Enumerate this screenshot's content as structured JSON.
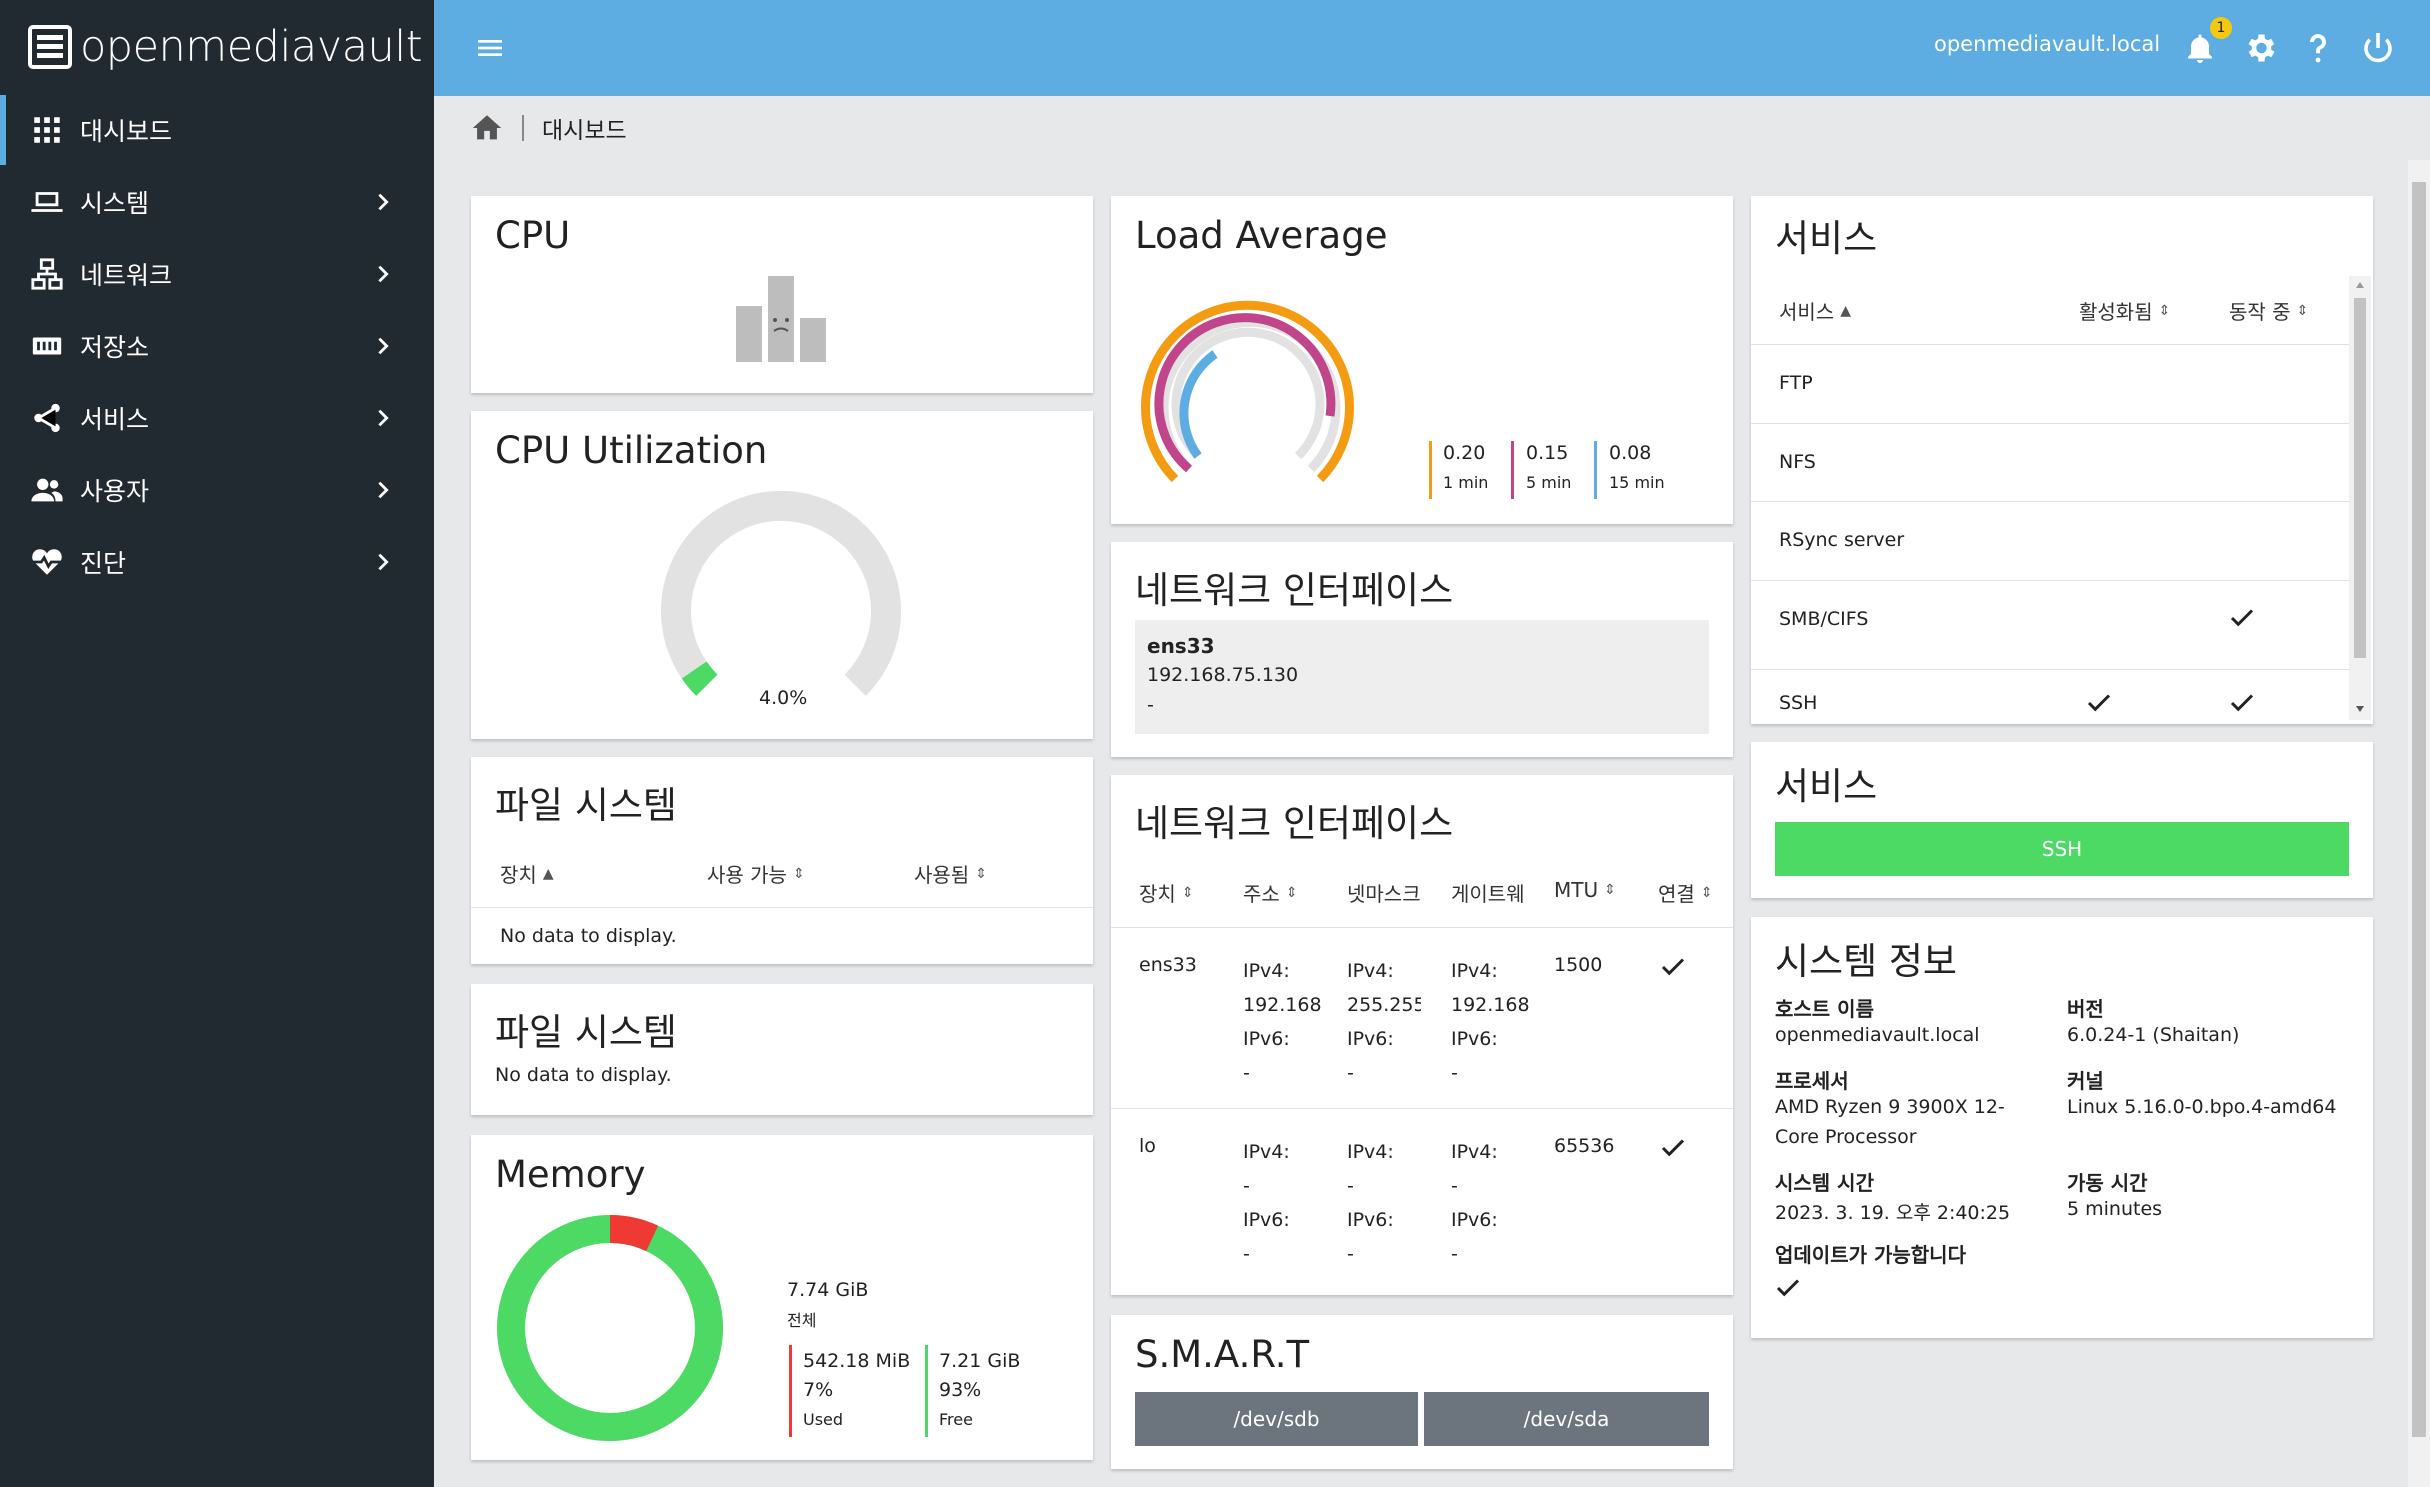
{
  "app": {
    "brand": "openmediavault",
    "hostname": "openmediavault.local",
    "notification_count": "1"
  },
  "sidebar": {
    "items": [
      {
        "label": "대시보드",
        "icon": "grid-icon",
        "active": true
      },
      {
        "label": "시스템",
        "icon": "laptop-icon"
      },
      {
        "label": "네트워크",
        "icon": "network-icon"
      },
      {
        "label": "저장소",
        "icon": "storage-icon"
      },
      {
        "label": "서비스",
        "icon": "share-icon"
      },
      {
        "label": "사용자",
        "icon": "users-icon"
      },
      {
        "label": "진단",
        "icon": "heartbeat-icon"
      }
    ]
  },
  "breadcrumb": {
    "current": "대시보드"
  },
  "cpu": {
    "title": "CPU"
  },
  "cpu_util": {
    "title": "CPU Utilization",
    "value_label": "4.0%",
    "value": 4.0
  },
  "filesystem1": {
    "title": "파일 시스템",
    "columns": [
      "장치",
      "사용 가능",
      "사용됨"
    ],
    "empty": "No data to display."
  },
  "filesystem2": {
    "title": "파일 시스템",
    "empty": "No data to display."
  },
  "memory": {
    "title": "Memory",
    "total": "7.74 GiB",
    "total_label": "전체",
    "used": "542.18 MiB",
    "used_pct": "7%",
    "used_label": "Used",
    "used_fraction": 0.07,
    "free": "7.21 GiB",
    "free_pct": "93%",
    "free_label": "Free"
  },
  "load": {
    "title": "Load Average",
    "items": [
      {
        "value": "0.20",
        "label": "1 min",
        "color": "#f39c12"
      },
      {
        "value": "0.15",
        "label": "5 min",
        "color": "#c0458a"
      },
      {
        "value": "0.08",
        "label": "15 min",
        "color": "#5dade2"
      }
    ]
  },
  "net1": {
    "title": "네트워크 인터페이스",
    "device": "ens33",
    "address": "192.168.75.130",
    "extra": "-"
  },
  "net2": {
    "title": "네트워크 인터페이스",
    "columns": [
      "장치",
      "주소",
      "넷마스크",
      "게이트웨",
      "MTU",
      "연결"
    ],
    "rows": [
      {
        "device": "ens33",
        "address": [
          "IPv4:",
          "192.168",
          "IPv6:",
          "-"
        ],
        "netmask": [
          "IPv4:",
          "255.255",
          "IPv6:",
          "-"
        ],
        "gateway": [
          "IPv4:",
          "192.168",
          "IPv6:",
          "-"
        ],
        "mtu": "1500"
      },
      {
        "device": "lo",
        "address": [
          "IPv4:",
          "-",
          "IPv6:",
          "-"
        ],
        "netmask": [
          "IPv4:",
          "-",
          "IPv6:",
          "-"
        ],
        "gateway": [
          "IPv4:",
          "-",
          "IPv6:",
          "-"
        ],
        "mtu": "65536"
      }
    ]
  },
  "smart": {
    "title": "S.M.A.R.T",
    "devices": [
      "/dev/sdb",
      "/dev/sda"
    ]
  },
  "services1": {
    "title": "서비스",
    "columns": [
      "서비스",
      "활성화됨",
      "동작 중"
    ],
    "rows": [
      {
        "name": "FTP",
        "enabled": false,
        "running": false
      },
      {
        "name": "NFS",
        "enabled": false,
        "running": false
      },
      {
        "name": "RSync server",
        "enabled": false,
        "running": false
      },
      {
        "name": "SMB/CIFS",
        "enabled": false,
        "running": true
      },
      {
        "name": "SSH",
        "enabled": true,
        "running": true
      }
    ]
  },
  "services2": {
    "title": "서비스",
    "ssh_label": "SSH",
    "color": "#4cd964"
  },
  "sysinfo": {
    "title": "시스템 정보",
    "hostname_label": "호스트 이름",
    "hostname": "openmediavault.local",
    "version_label": "버전",
    "version": "6.0.24-1 (Shaitan)",
    "cpu_label": "프로세서",
    "cpu_line1": "AMD Ryzen 9 3900X 12-",
    "cpu_line2": "Core Processor",
    "kernel_label": "커널",
    "kernel": "Linux 5.16.0-0.bpo.4-amd64",
    "time_label": "시스템 시간",
    "time": "2023. 3. 19. 오후 2:40:25",
    "uptime_label": "가동 시간",
    "uptime": "5 minutes",
    "update_label": "업데이트가 가능합니다"
  }
}
